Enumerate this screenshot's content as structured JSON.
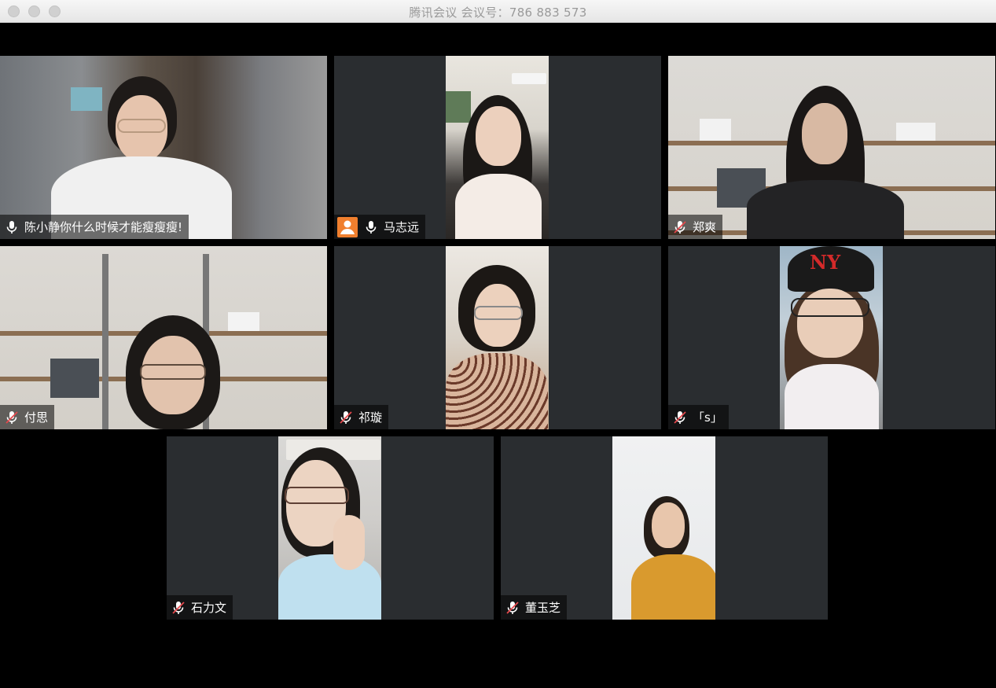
{
  "window": {
    "title": "腾讯会议 会议号：786 883 573"
  },
  "participants": [
    {
      "name": "陈小静你什么时候才能瘦瘦瘦!",
      "mic": "on"
    },
    {
      "name": "马志远",
      "mic": "on",
      "avatar": true
    },
    {
      "name": "郑爽",
      "mic": "muted"
    },
    {
      "name": "付思",
      "mic": "muted"
    },
    {
      "name": "祁璇",
      "mic": "muted"
    },
    {
      "name": "「s」",
      "mic": "muted"
    },
    {
      "name": "石力文",
      "mic": "muted"
    },
    {
      "name": "董玉芝",
      "mic": "muted"
    }
  ],
  "icons": {
    "mic_on": "microphone-icon",
    "mic_muted": "microphone-muted-icon",
    "avatar": "user-avatar-icon"
  },
  "colors": {
    "tile_bg": "#2a2d30",
    "avatar_accent": "#f07f2e",
    "muted_slash": "#e5484d"
  }
}
